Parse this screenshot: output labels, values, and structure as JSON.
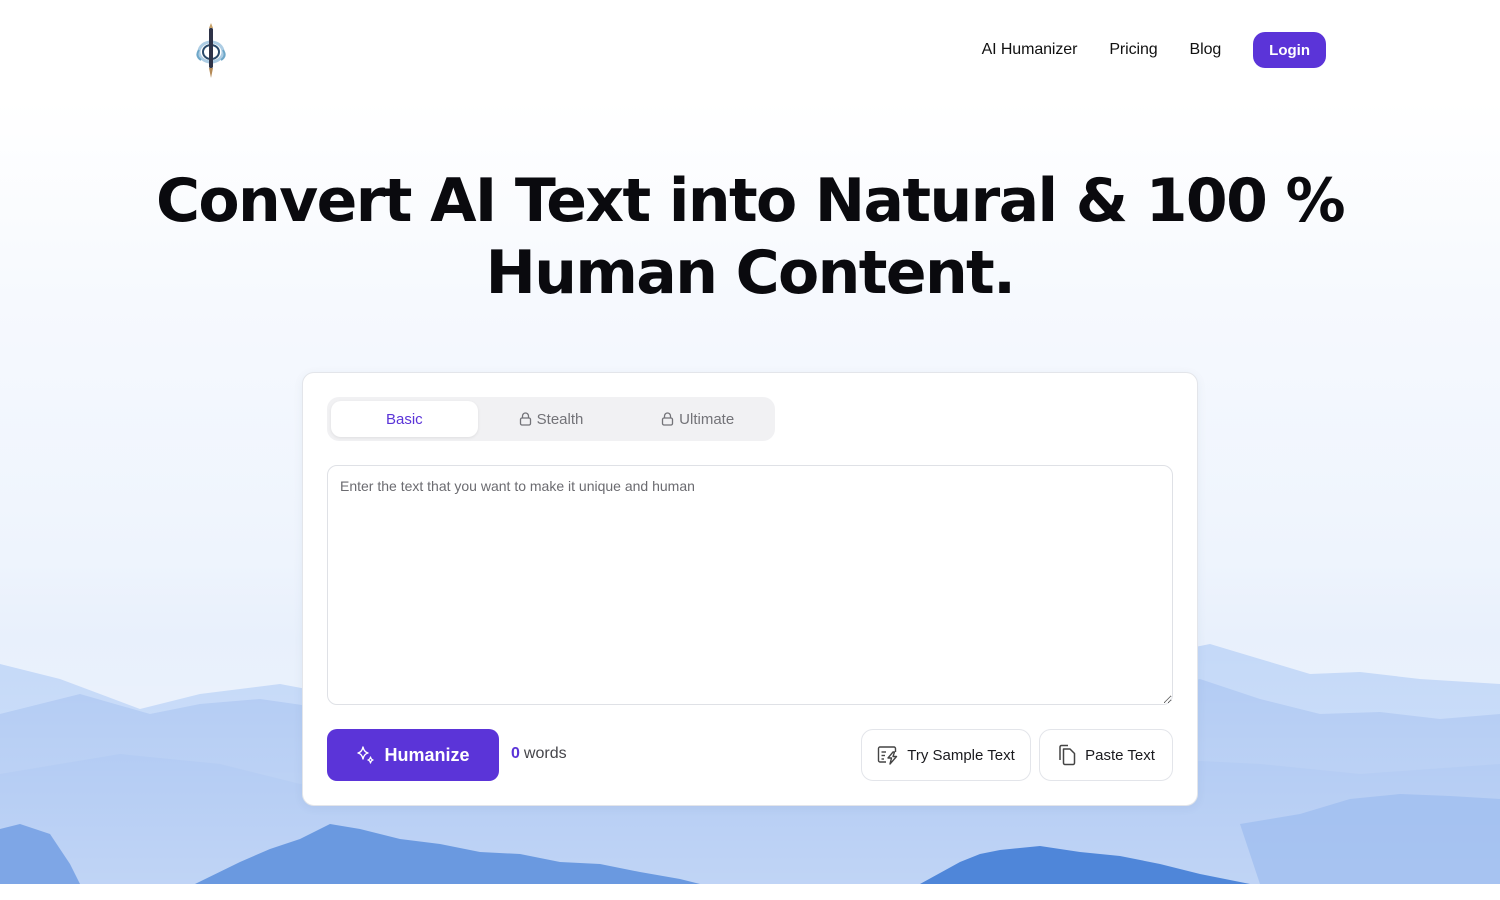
{
  "header": {
    "logo_alt": "pen-compass-logo",
    "nav": [
      {
        "label": "AI Humanizer"
      },
      {
        "label": "Pricing"
      },
      {
        "label": "Blog"
      }
    ],
    "login_label": "Login"
  },
  "hero": {
    "headline_line1": "Convert AI Text into Natural & 100 %",
    "headline_line2": "Human Content."
  },
  "editor": {
    "tabs": [
      {
        "label": "Basic",
        "active": true,
        "locked": false
      },
      {
        "label": "Stealth",
        "active": false,
        "locked": true
      },
      {
        "label": "Ultimate",
        "active": false,
        "locked": true
      }
    ],
    "input": {
      "value": "",
      "placeholder": "Enter the text that you want to make it unique and human"
    },
    "humanize_label": "Humanize",
    "word_count": "0",
    "word_count_unit": "words",
    "sample_label": "Try Sample Text",
    "paste_label": "Paste Text"
  },
  "colors": {
    "accent": "#5b34d8",
    "mountain_light": "#b7d0f6",
    "mountain_dark": "#5f92de"
  }
}
